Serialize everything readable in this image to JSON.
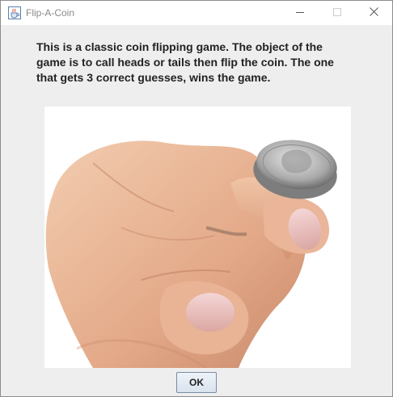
{
  "window": {
    "title": "Flip-A-Coin",
    "icon": "java-cup-icon",
    "controls": [
      "minimize-icon",
      "maximize-icon",
      "close-icon"
    ]
  },
  "dialog": {
    "message": "This is a classic coin flipping game.  The object of the\ngame is to call heads or tails then flip the coin.  The one\nthat gets 3 correct  guesses, wins the game.",
    "image": "hand-flipping-coin",
    "ok_label": "OK"
  },
  "colors": {
    "background": "#eeeeee",
    "titlebar": "#ffffff",
    "button_border": "#7a8ba3"
  }
}
